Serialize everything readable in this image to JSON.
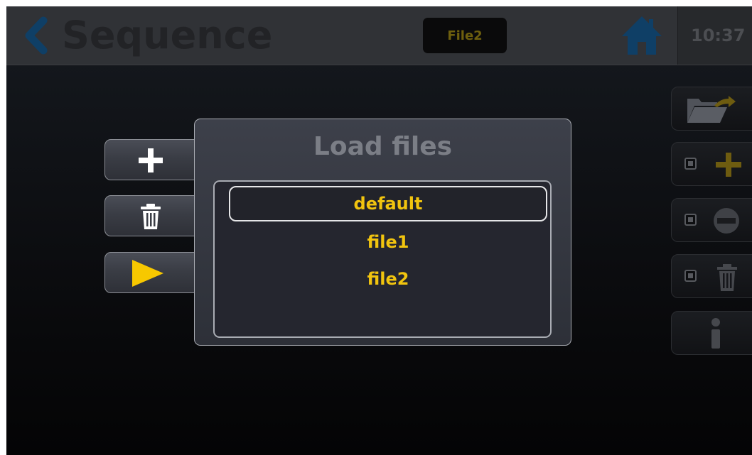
{
  "header": {
    "title": "Sequence",
    "current_file": "File2",
    "time": "10:37",
    "back_icon": "chevron-left-icon",
    "home_icon": "home-icon",
    "title_color": "#222326",
    "accent_color": "#0f3f66"
  },
  "side_buttons": [
    {
      "icon": "plus-icon"
    },
    {
      "icon": "trash-icon"
    },
    {
      "icon": "play-icon",
      "color": "#f7c800"
    }
  ],
  "right_buttons": [
    {
      "icon": "folder-open-icon"
    },
    {
      "icon": "plus-icon",
      "has_checkbox": true
    },
    {
      "icon": "minus-circle-icon",
      "has_checkbox": true
    },
    {
      "icon": "trash-icon",
      "has_checkbox": true
    },
    {
      "icon": "info-icon"
    }
  ],
  "dialog": {
    "title": "Load files",
    "files": [
      "default",
      "file1",
      "file2"
    ],
    "selected": "default",
    "item_color": "#f1c40f"
  }
}
